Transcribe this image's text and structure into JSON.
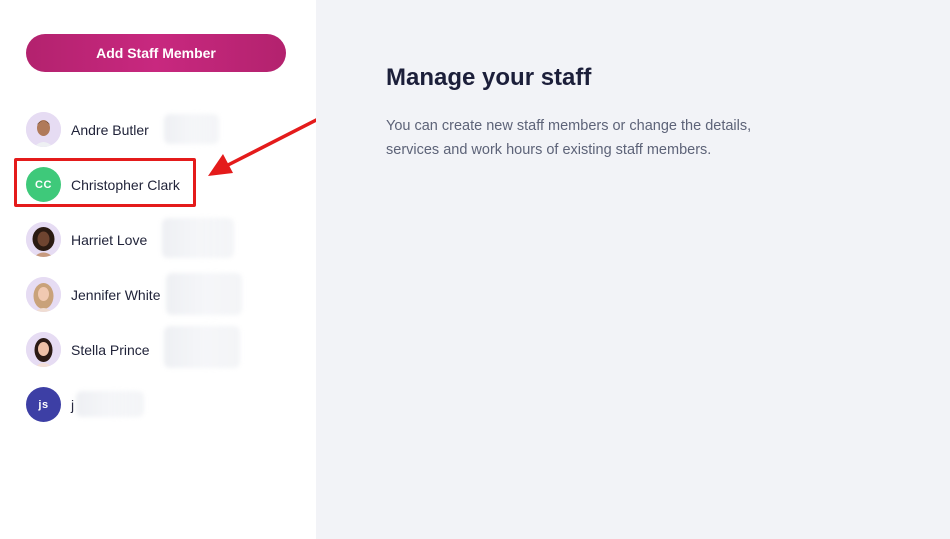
{
  "sidebar": {
    "add_button_label": "Add Staff Member",
    "staff": [
      {
        "name": "Andre Butler",
        "initials": "",
        "avatar_color": "#e6dcf3",
        "avatar_type": "photo"
      },
      {
        "name": "Christopher Clark",
        "initials": "CC",
        "avatar_color": "#3ec97a",
        "avatar_type": "initials"
      },
      {
        "name": "Harriet Love",
        "initials": "",
        "avatar_color": "#e6dcf3",
        "avatar_type": "photo"
      },
      {
        "name": "Jennifer White",
        "initials": "",
        "avatar_color": "#e6dcf3",
        "avatar_type": "photo"
      },
      {
        "name": "Stella Prince",
        "initials": "",
        "avatar_color": "#e6dcf3",
        "avatar_type": "photo"
      },
      {
        "name": "j",
        "initials": "js",
        "avatar_color": "#3d3fa5",
        "avatar_type": "initials"
      }
    ]
  },
  "main": {
    "title": "Manage your staff",
    "description": "You can create new staff members or change the details, services and work hours of existing staff members."
  },
  "colors": {
    "accent": "#c8287f",
    "annotation": "#e41b1b",
    "main_bg": "#f2f3f7"
  }
}
